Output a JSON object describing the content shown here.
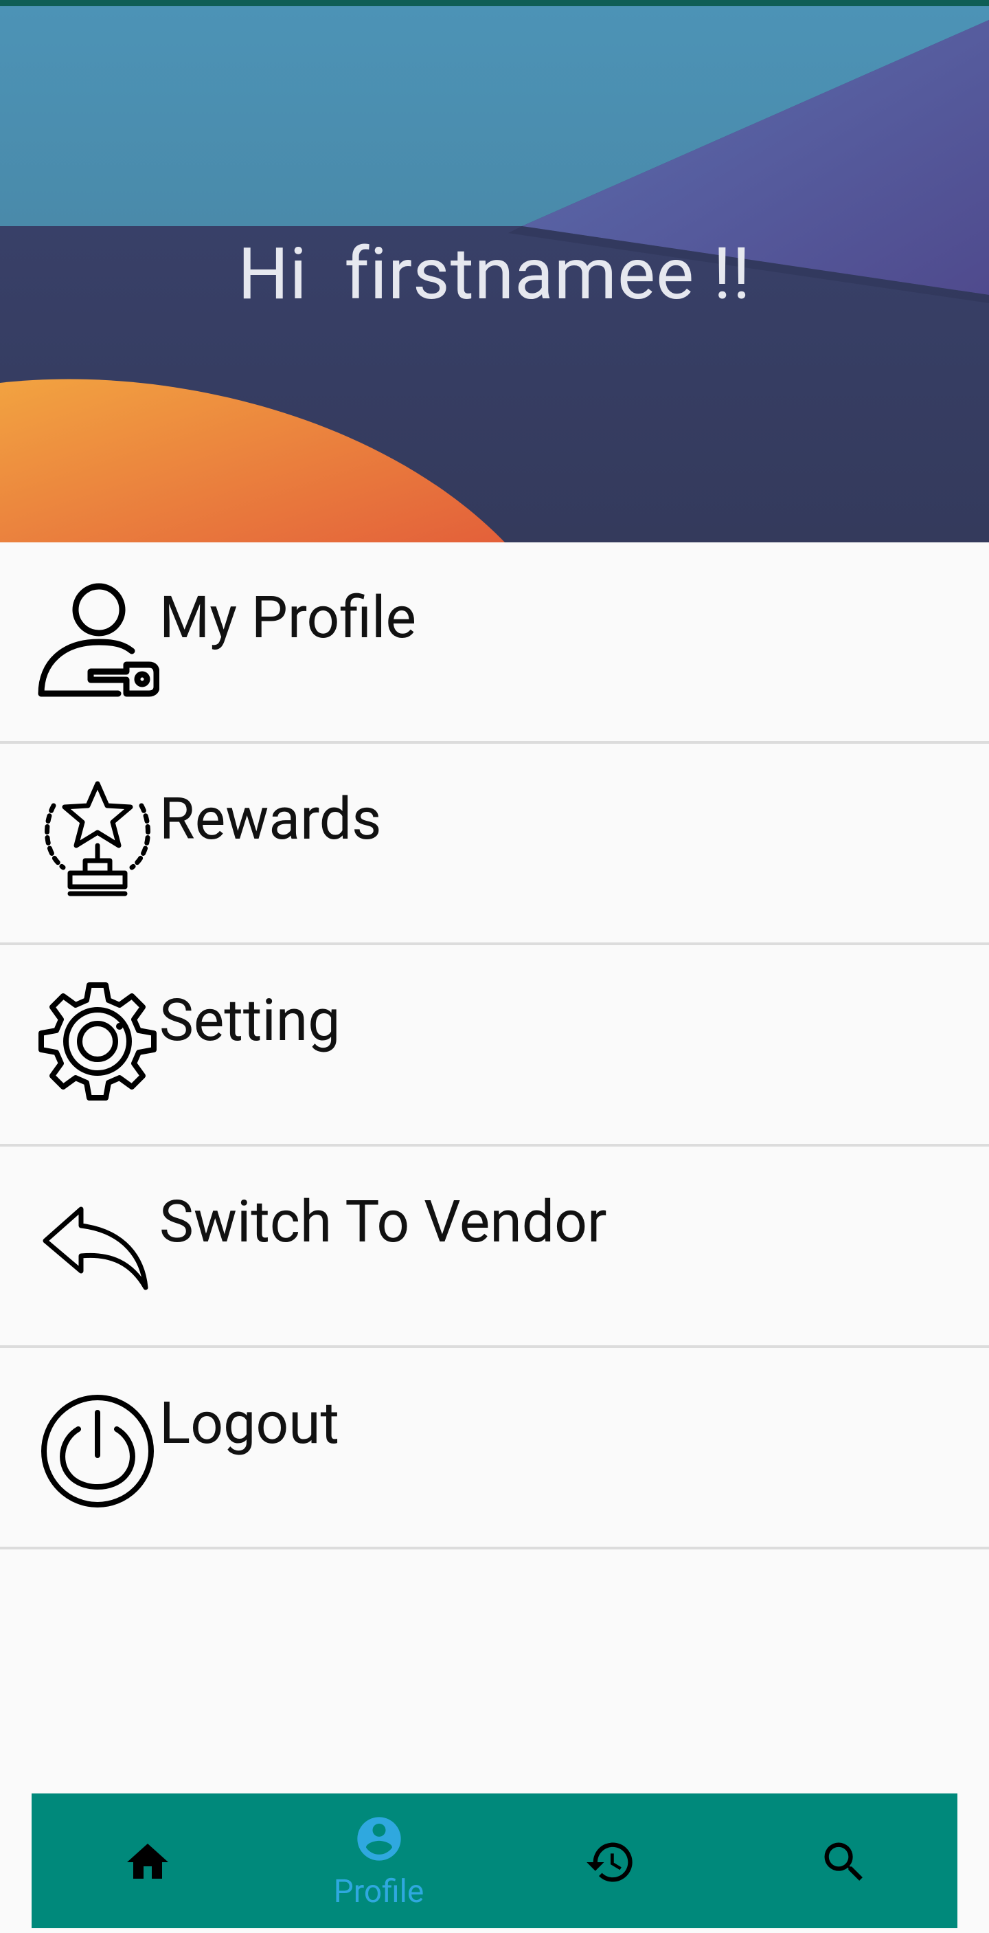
{
  "header": {
    "greeting": "Hi  firstnamee !!"
  },
  "menu": {
    "items": [
      {
        "label": "My Profile",
        "icon": "user-key-icon"
      },
      {
        "label": "Rewards",
        "icon": "trophy-star-icon"
      },
      {
        "label": "Setting",
        "icon": "gear-icon"
      },
      {
        "label": "Switch To Vendor",
        "icon": "reply-arrow-icon"
      },
      {
        "label": "Logout",
        "icon": "power-icon"
      }
    ]
  },
  "bottom_nav": {
    "items": [
      {
        "icon": "home-icon",
        "label": "",
        "active": false
      },
      {
        "icon": "account-circle-icon",
        "label": "Profile",
        "active": true
      },
      {
        "icon": "history-icon",
        "label": "",
        "active": false
      },
      {
        "icon": "search-icon",
        "label": "",
        "active": false
      }
    ],
    "bar_color": "#00897b",
    "active_color": "#2fa8df"
  }
}
